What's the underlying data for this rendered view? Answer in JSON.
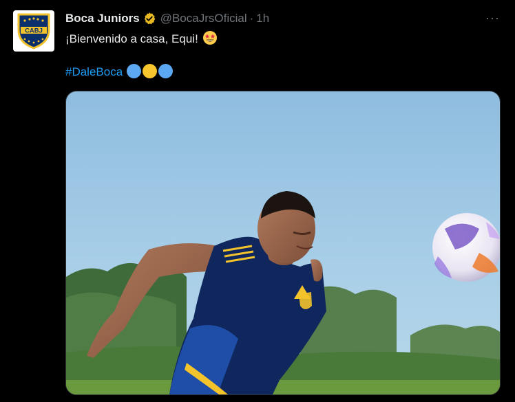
{
  "tweet": {
    "author_name": "Boca Juniors",
    "handle": "@BocaJrsOficial",
    "separator": "·",
    "time": "1h",
    "more_label": "···",
    "text": "¡Bienvenido a casa, Equi!",
    "emoji": "star-struck-emoji",
    "hashtag": "#DaleBoca",
    "hashtag_emojis": [
      "blue-circle",
      "yellow-circle",
      "blue-circle"
    ]
  },
  "avatar": {
    "crest_text": "CABJ"
  },
  "colors": {
    "background": "#000000",
    "text": "#e7e9ea",
    "muted": "#71767b",
    "link": "#1d9bf0",
    "verified_badge": "#e8b923",
    "boca_blue": "#0b2f6b",
    "boca_gold": "#f3c32c",
    "circle_blue": "#5da8f3",
    "circle_yellow": "#f7c52d"
  }
}
